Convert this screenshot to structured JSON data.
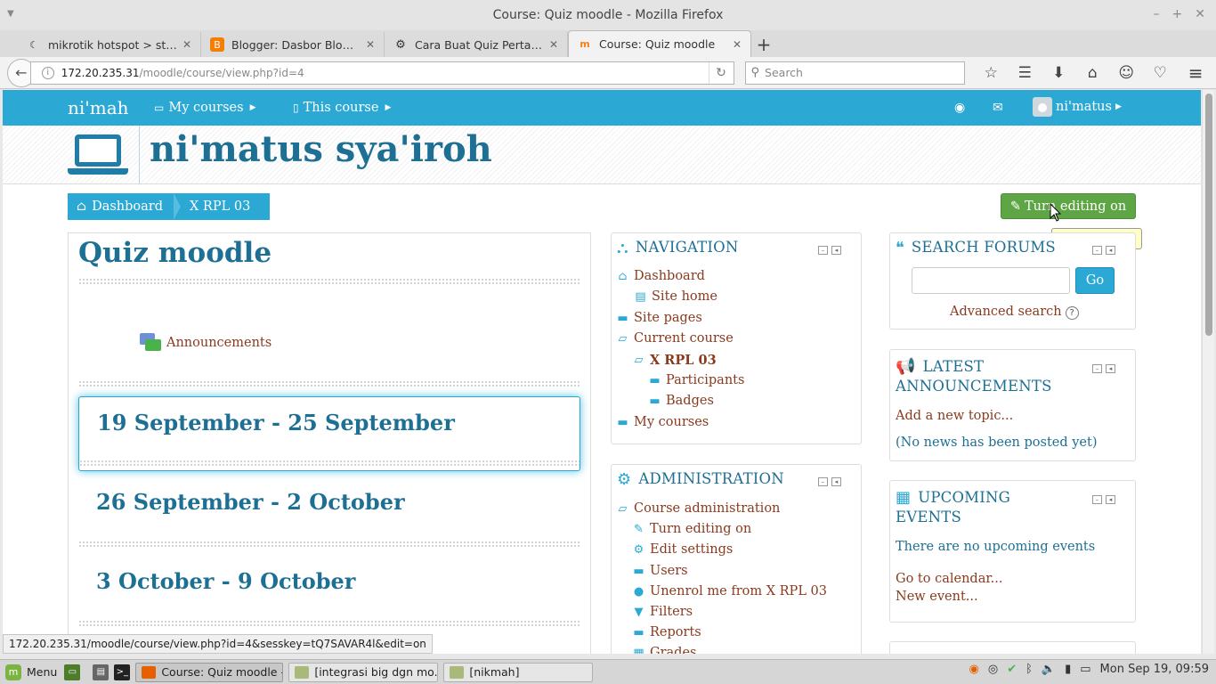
{
  "window": {
    "title": "Course: Quiz moodle - Mozilla Firefox"
  },
  "tabs": [
    {
      "label": "mikrotik hotspot > status",
      "icon": "mikrotik-icon",
      "active": false
    },
    {
      "label": "Blogger: Dasbor Blogger",
      "icon": "blogger-icon",
      "active": false
    },
    {
      "label": "Cara Buat Quiz Pertanya...",
      "icon": "ubuntu-icon",
      "active": false
    },
    {
      "label": "Course: Quiz moodle",
      "icon": "moodle-icon",
      "active": true
    }
  ],
  "toolbar": {
    "url_host": "172.20.235.31",
    "url_path": "/moodle/course/view.php?id=4",
    "search_placeholder": "Search"
  },
  "moodle": {
    "brand": "ni'mah",
    "menus": [
      "My courses",
      "This course"
    ],
    "user": "ni'matus",
    "site_name": "ni'matus sya'iroh",
    "breadcrumb": [
      "Dashboard",
      "X RPL 03"
    ],
    "edit_button": "Turn editing on",
    "tooltip": "Turn editing on"
  },
  "course": {
    "title": "Quiz moodle",
    "announcements": "Announcements",
    "sections": [
      "19 September - 25 September",
      "26 September - 2 October",
      "3 October - 9 October"
    ]
  },
  "navigation": {
    "title": "NAVIGATION",
    "items": [
      {
        "label": "Dashboard",
        "icon": "home-icon"
      },
      {
        "label": "Site home",
        "icon": "page-icon"
      },
      {
        "label": "Site pages",
        "icon": "folder-icon"
      },
      {
        "label": "Current course",
        "icon": "folder-open-icon"
      },
      {
        "label": "X RPL 03",
        "icon": "folder-open-icon"
      },
      {
        "label": "Participants",
        "icon": "folder-icon"
      },
      {
        "label": "Badges",
        "icon": "folder-icon"
      },
      {
        "label": "My courses",
        "icon": "folder-icon"
      }
    ]
  },
  "administration": {
    "title": "ADMINISTRATION",
    "items": [
      {
        "label": "Course administration",
        "icon": "folder-open-icon"
      },
      {
        "label": "Turn editing on",
        "icon": "pencil-icon"
      },
      {
        "label": "Edit settings",
        "icon": "cogs-icon"
      },
      {
        "label": "Users",
        "icon": "folder-icon"
      },
      {
        "label": "Unenrol me from X RPL 03",
        "icon": "user-icon"
      },
      {
        "label": "Filters",
        "icon": "filter-icon"
      },
      {
        "label": "Reports",
        "icon": "folder-icon"
      },
      {
        "label": "Grades",
        "icon": "table-icon"
      }
    ]
  },
  "search_forums": {
    "title": "SEARCH FORUMS",
    "go": "Go",
    "advanced": "Advanced search"
  },
  "latest_announcements": {
    "title_1": "LATEST",
    "title_2": "ANNOUNCEMENTS",
    "add": "Add a new topic...",
    "empty": "(No news has been posted yet)"
  },
  "upcoming_events": {
    "title_1": "UPCOMING",
    "title_2": "EVENTS",
    "none": "There are no upcoming events",
    "calendar": "Go to calendar...",
    "new_event": "New event..."
  },
  "statusbar": {
    "link": "172.20.235.31/moodle/course/view.php?id=4&sesskey=tQ7SAVAR4l&edit=on"
  },
  "taskbar": {
    "menu": "Menu",
    "windows": [
      {
        "label": "Course: Quiz moodle -...",
        "active": true
      },
      {
        "label": "[integrasi big dgn mo...",
        "active": false
      },
      {
        "label": "[nikmah]",
        "active": false
      }
    ],
    "clock": "Mon Sep 19, 09:59"
  },
  "colors": {
    "moodle_blue": "#2ba8d3",
    "heading_teal": "#1d6f94",
    "link_brown": "#8a3a1e",
    "edit_green": "#5ea645"
  }
}
